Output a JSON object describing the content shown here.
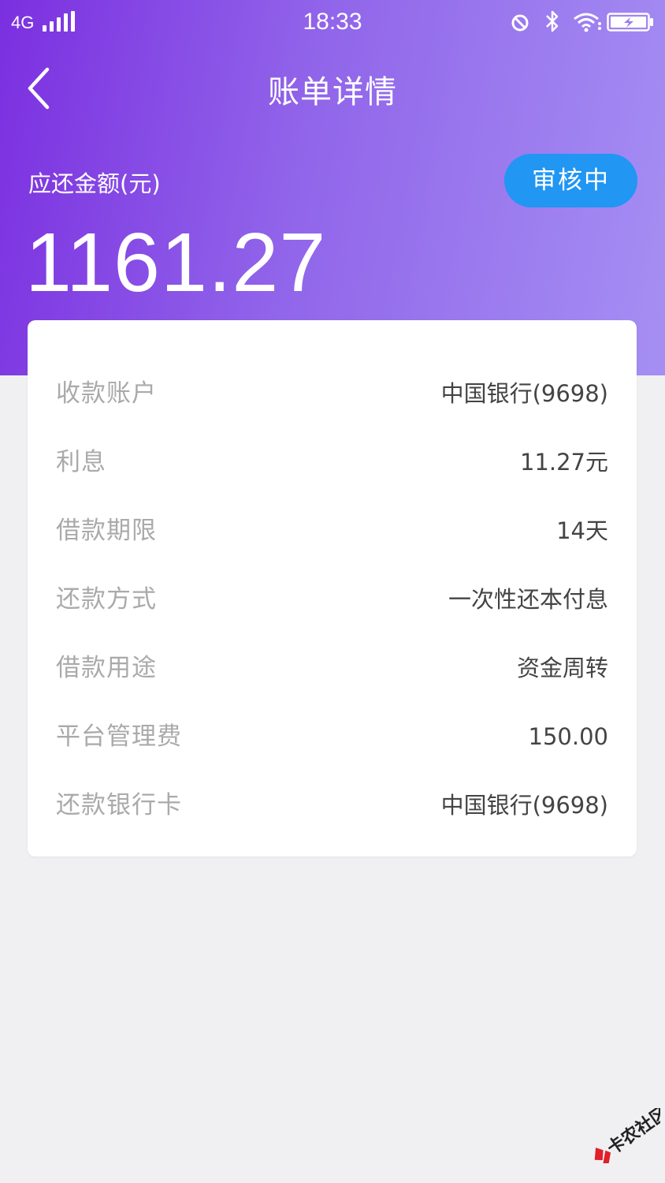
{
  "status_bar": {
    "network": "4G",
    "time": "18:33"
  },
  "header": {
    "title": "账单详情",
    "back_icon": "chevron-left-icon"
  },
  "summary": {
    "amount_label": "应还金额(元)",
    "amount": "1161.27",
    "status": "审核中"
  },
  "details": [
    {
      "label": "收款账户",
      "value": "中国银行(9698)"
    },
    {
      "label": "利息",
      "value": "11.27元"
    },
    {
      "label": "借款期限",
      "value": "14天"
    },
    {
      "label": "还款方式",
      "value": "一次性还本付息"
    },
    {
      "label": "借款用途",
      "value": "资金周转"
    },
    {
      "label": "平台管理费",
      "value": "150.00"
    },
    {
      "label": "还款银行卡",
      "value": "中国银行(9698)"
    }
  ],
  "watermark": {
    "text": "卡农社区"
  },
  "colors": {
    "gradient_start": "#7b2fe0",
    "gradient_end": "#a58ff3",
    "badge": "#2196f3",
    "label_gray": "#aaaaaa",
    "value_dark": "#444444",
    "page_bg": "#f0f0f2"
  }
}
